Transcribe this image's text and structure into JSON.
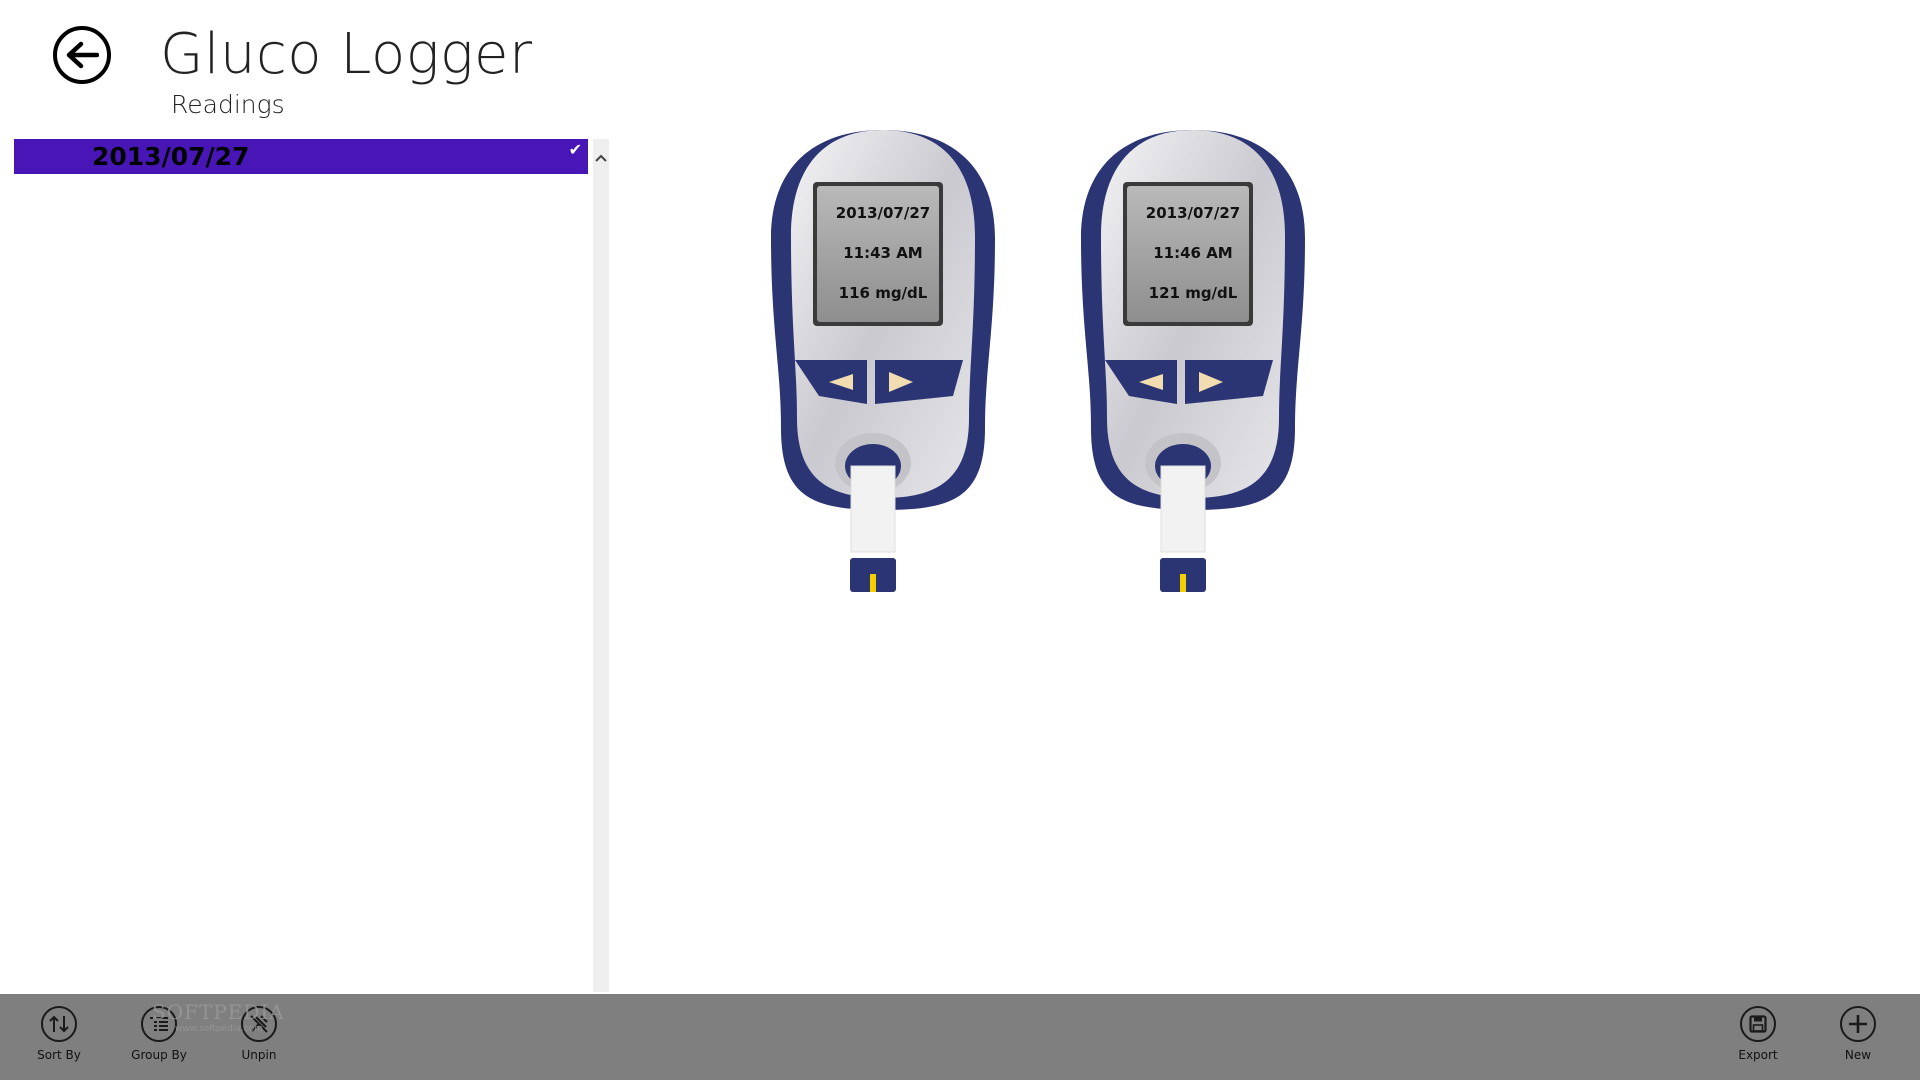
{
  "header": {
    "title": "Gluco Logger",
    "subtitle": "Readings"
  },
  "list": {
    "items": [
      {
        "label": "2013/07/27",
        "selected": true
      }
    ]
  },
  "readings": [
    {
      "date": "2013/07/27",
      "time": "11:43 AM",
      "value": "116 mg/dL"
    },
    {
      "date": "2013/07/27",
      "time": "11:46 AM",
      "value": "121 mg/dL"
    }
  ],
  "app_bar": {
    "left": [
      {
        "label": "Sort By",
        "icon": "sort-icon"
      },
      {
        "label": "Group By",
        "icon": "group-icon"
      },
      {
        "label": "Unpin",
        "icon": "unpin-icon"
      }
    ],
    "right": [
      {
        "label": "Export",
        "icon": "save-icon"
      },
      {
        "label": "New",
        "icon": "add-icon"
      }
    ]
  },
  "watermark": {
    "brand": "SOFTPEDIA",
    "url": "www.softpedia.com"
  },
  "colors": {
    "selection": "#4816b6",
    "app_bar": "#7f7f7f",
    "meter_blue": "#2c3574"
  }
}
